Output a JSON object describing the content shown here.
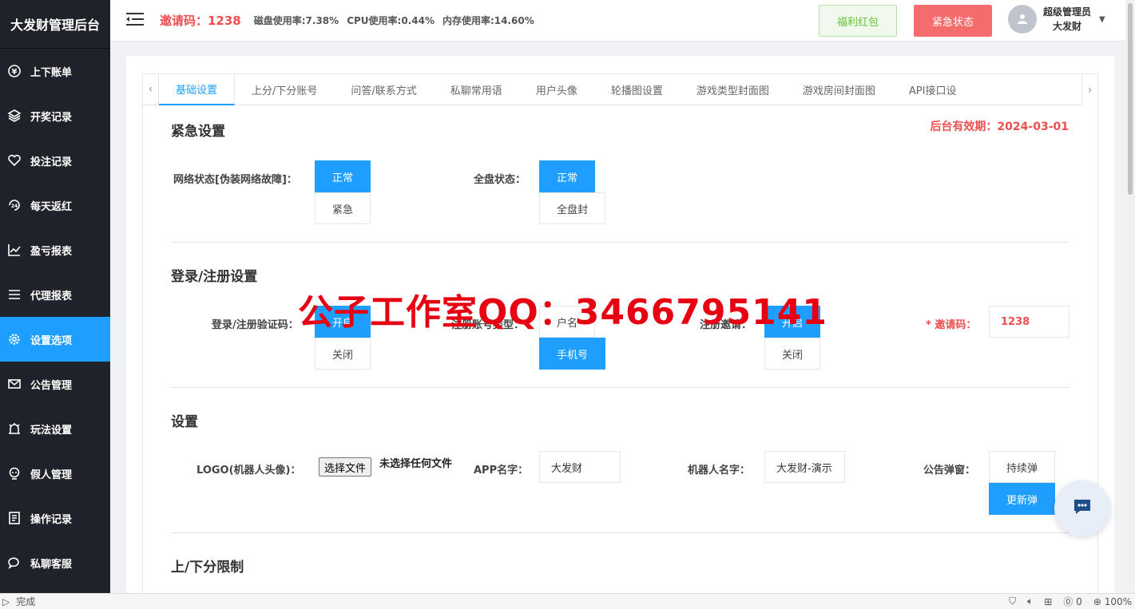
{
  "sidebar": {
    "brand": "大发财管理后台",
    "items": [
      {
        "label": "上下账单",
        "icon": "coin-icon"
      },
      {
        "label": "开奖记录",
        "icon": "layers-icon"
      },
      {
        "label": "投注记录",
        "icon": "heart-icon"
      },
      {
        "label": "每天返红",
        "icon": "24h-icon"
      },
      {
        "label": "盈亏报表",
        "icon": "line-chart-icon"
      },
      {
        "label": "代理报表",
        "icon": "list-icon"
      },
      {
        "label": "设置选项",
        "icon": "gear-icon"
      },
      {
        "label": "公告管理",
        "icon": "mail-icon"
      },
      {
        "label": "玩法设置",
        "icon": "alarm-icon"
      },
      {
        "label": "假人管理",
        "icon": "bot-icon"
      },
      {
        "label": "操作记录",
        "icon": "log-icon"
      },
      {
        "label": "私聊客服",
        "icon": "chat-icon"
      }
    ],
    "active_index": 6
  },
  "header": {
    "invite": "邀请码：1238",
    "disk": "磁盘使用率:7.38%",
    "cpu": "CPU使用率:0.44%",
    "mem": "内存使用率:14.60%",
    "welfare_btn": "福利红包",
    "emergency_btn": "紧急状态",
    "user_role": "超级管理员",
    "user_name": "大发财"
  },
  "tabs": [
    "基础设置",
    "上分/下分账号",
    "问答/联系方式",
    "私聊常用语",
    "用户头像",
    "轮播图设置",
    "游戏类型封面图",
    "游戏房间封面图",
    "API接口设"
  ],
  "expire": "后台有效期：2024-03-01",
  "emergency": {
    "title": "紧急设置",
    "network_label": "网络状态[伪装网络故障]：",
    "network_opts": [
      "正常",
      "紧急"
    ],
    "board_label": "全盘状态：",
    "board_opts": [
      "正常",
      "全盘封"
    ]
  },
  "login": {
    "title": "登录/注册设置",
    "captcha_label": "登录/注册验证码：",
    "captcha_opts": [
      "开启",
      "关闭"
    ],
    "acct_label": "注册账号类型：",
    "acct_opts": [
      "户名",
      "手机号"
    ],
    "reg_invite_label": "注册邀请：",
    "reg_invite_opts": [
      "开启",
      "关闭"
    ],
    "invite_label": "邀请码：",
    "invite_value": "1238"
  },
  "settings": {
    "title": "设置",
    "logo_label": "LOGO(机器人头像)：",
    "file_btn": "选择文件",
    "file_none": "未选择任何文件",
    "app_label": "APP名字：",
    "app_value": "大发财",
    "robot_label": "机器人名字：",
    "robot_value": "大发财-演示",
    "popup_label": "公告弹窗：",
    "popup_opts": [
      "持续弹",
      "更新弹"
    ]
  },
  "limits": {
    "title": "上/下分限制"
  },
  "watermark": "公子工作室QQ：3466795141",
  "statusbar": {
    "text": "完成",
    "zoom": "100%",
    "count": "0"
  }
}
